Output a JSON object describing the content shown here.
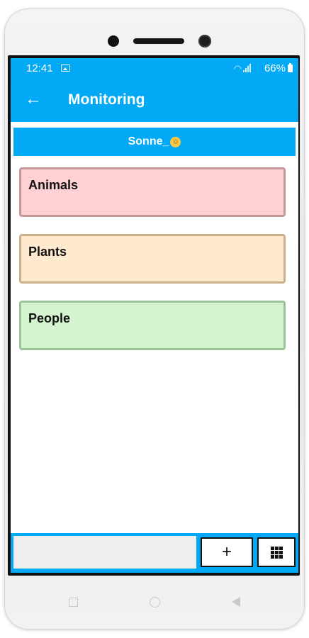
{
  "status": {
    "time": "12:41",
    "battery": "66%",
    "icons": [
      "image-icon",
      "wifi-icon",
      "signal-icon",
      "battery-icon"
    ]
  },
  "header": {
    "back_icon": "arrow-left-icon",
    "title": "Monitoring"
  },
  "user": {
    "name": "Sonne_",
    "emoji": "smiley-emoji-icon"
  },
  "categories": [
    {
      "label": "Animals",
      "bg": "#ffd1d4",
      "border": "#c49799"
    },
    {
      "label": "Plants",
      "bg": "#ffe9cf",
      "border": "#cbb08c"
    },
    {
      "label": "People",
      "bg": "#d5f5d0",
      "border": "#9cc399"
    }
  ],
  "input": {
    "value": "",
    "placeholder": ""
  },
  "buttons": {
    "add": "+",
    "grid_icon": "grid-icon"
  },
  "colors": {
    "accent": "#03a9f4"
  }
}
